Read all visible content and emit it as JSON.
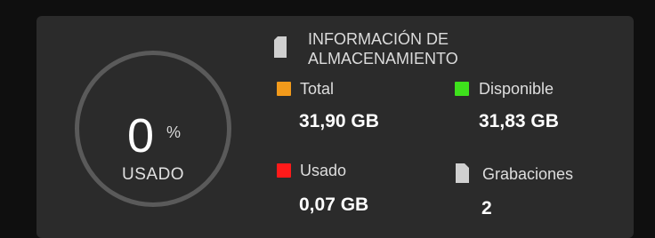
{
  "storage_card": {
    "title_line1": "INFORMACIÓN DE",
    "title_line2": "ALMACENAMIENTO",
    "usage_percent": "0",
    "percent_sign": "%",
    "used_caption": "USADO",
    "stats": {
      "total": {
        "label": "Total",
        "value": "31,90 GB",
        "color": "#f29a1b"
      },
      "available": {
        "label": "Disponible",
        "value": "31,83 GB",
        "color": "#3ee11c"
      },
      "used": {
        "label": "Usado",
        "value": "0,07 GB",
        "color": "#ff1a1a"
      },
      "recordings": {
        "label": "Grabaciones",
        "value": "2",
        "icon": "file-icon"
      }
    },
    "title_icon": "sd-card-icon",
    "ring_color": "#5a5a5a",
    "background": "#2b2b2b"
  }
}
